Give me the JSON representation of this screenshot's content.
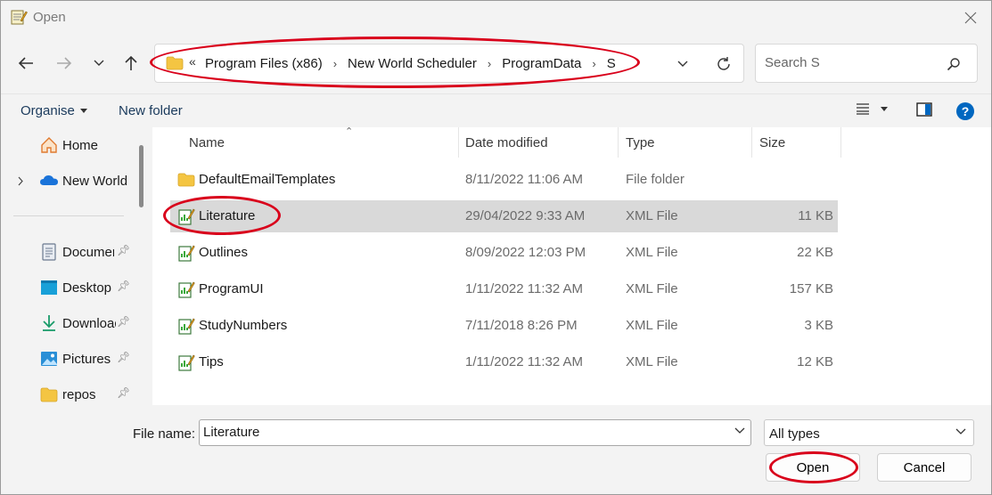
{
  "window": {
    "title": "Open",
    "colors": {
      "accent": "#0067c0",
      "annotation": "#d9001b",
      "selected_row": "#d9d9d9"
    }
  },
  "address_bar": {
    "overflow_label": "«",
    "crumbs": [
      "Program Files (x86)",
      "New World Scheduler",
      "ProgramData",
      "S"
    ]
  },
  "search": {
    "placeholder": "Search S"
  },
  "toolbar": {
    "organise_label": "Organise",
    "new_folder_label": "New folder"
  },
  "sidebar": {
    "items": [
      {
        "label": "Home",
        "icon": "home-icon"
      },
      {
        "label": "New World",
        "icon": "onedrive-cloud-icon"
      },
      {
        "label": "Documents",
        "icon": "documents-icon",
        "pinned": true
      },
      {
        "label": "Desktop",
        "icon": "desktop-icon",
        "pinned": true
      },
      {
        "label": "Downloads",
        "icon": "download-icon",
        "pinned": true
      },
      {
        "label": "Pictures",
        "icon": "pictures-icon",
        "pinned": true
      },
      {
        "label": "repos",
        "icon": "folder-icon",
        "pinned": true
      }
    ]
  },
  "list": {
    "columns": [
      "Name",
      "Date modified",
      "Type",
      "Size"
    ],
    "rows": [
      {
        "name": "DefaultEmailTemplates",
        "date": "8/11/2022 11:06 AM",
        "type": "File folder",
        "size": "",
        "icon": "folder-icon"
      },
      {
        "name": "Literature",
        "date": "29/04/2022 9:33 AM",
        "type": "XML File",
        "size": "11 KB",
        "icon": "xml-file-icon",
        "selected": true
      },
      {
        "name": "Outlines",
        "date": "8/09/2022 12:03 PM",
        "type": "XML File",
        "size": "22 KB",
        "icon": "xml-file-icon"
      },
      {
        "name": "ProgramUI",
        "date": "1/11/2022 11:32 AM",
        "type": "XML File",
        "size": "157 KB",
        "icon": "xml-file-icon"
      },
      {
        "name": "StudyNumbers",
        "date": "7/11/2018 8:26 PM",
        "type": "XML File",
        "size": "3 KB",
        "icon": "xml-file-icon"
      },
      {
        "name": "Tips",
        "date": "1/11/2022 11:32 AM",
        "type": "XML File",
        "size": "12 KB",
        "icon": "xml-file-icon"
      }
    ]
  },
  "bottom": {
    "file_name_label": "File name:",
    "file_name_value": "Literature",
    "file_type": "All types",
    "open_label": "Open",
    "cancel_label": "Cancel"
  }
}
